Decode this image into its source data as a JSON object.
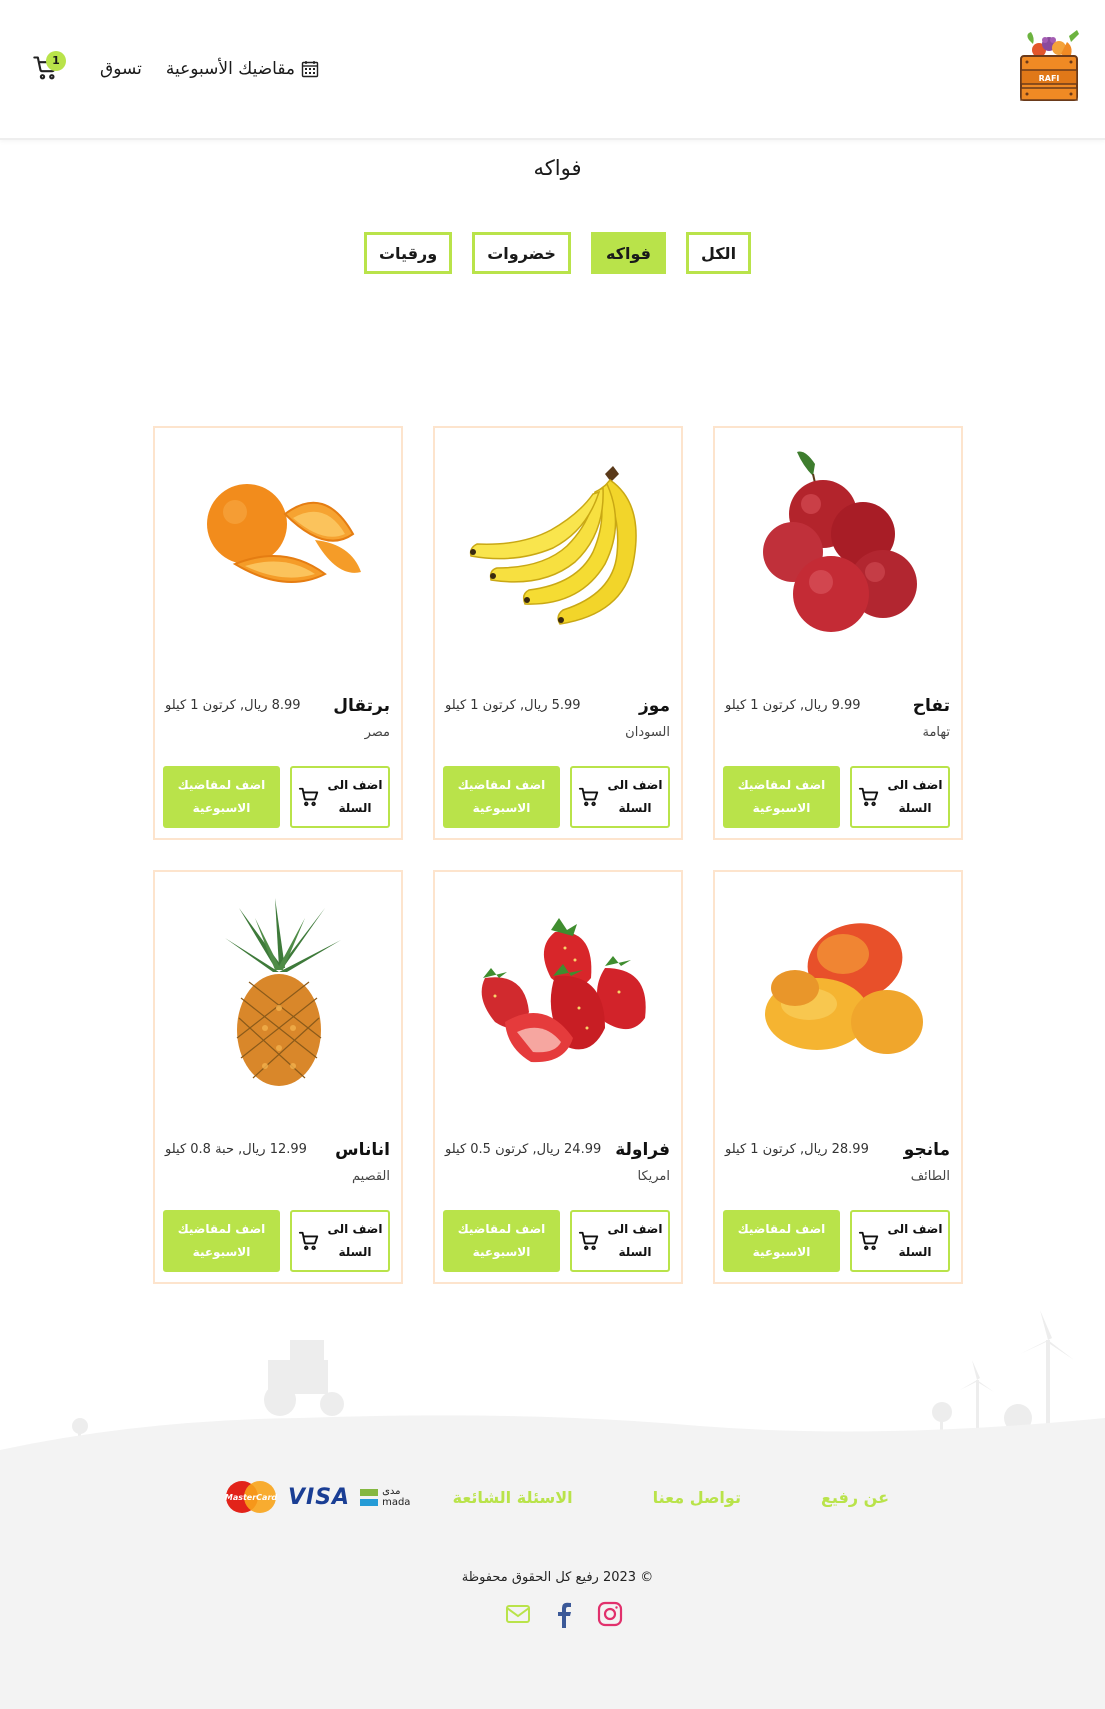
{
  "header": {
    "cart_count": "1",
    "nav_shop": "تسوق",
    "nav_weekly": "مقاضيك الأسبوعية",
    "logo_text": "RAFI"
  },
  "page_title": "فواكه",
  "filters": [
    {
      "label": "الكل",
      "active": false
    },
    {
      "label": "فواكه",
      "active": true
    },
    {
      "label": "خضروات",
      "active": false
    },
    {
      "label": "ورقيات",
      "active": false
    }
  ],
  "buttons": {
    "add_to_cart_line1": "اضف الى",
    "add_to_cart_line2": "السلة",
    "add_weekly_line1": "اضف لمقاضيك",
    "add_weekly_line2": "الاسبوعية"
  },
  "products": [
    {
      "name": "تفاح",
      "price": "9.99 ريال, كرتون 1 كيلو",
      "origin": "تهامة",
      "image": "apple"
    },
    {
      "name": "موز",
      "price": "5.99 ريال, كرتون 1 كيلو",
      "origin": "السودان",
      "image": "banana"
    },
    {
      "name": "برتقال",
      "price": "8.99 ريال, كرتون 1 كيلو",
      "origin": "مصر",
      "image": "orange"
    },
    {
      "name": "مانجو",
      "price": "28.99 ريال, كرتون 1 كيلو",
      "origin": "الطائف",
      "image": "mango"
    },
    {
      "name": "فراولة",
      "price": "24.99 ريال, كرتون 0.5 كيلو",
      "origin": "امريكا",
      "image": "strawberry"
    },
    {
      "name": "اناناس",
      "price": "12.99 ريال, حبة 0.8 كيلو",
      "origin": "القصيم",
      "image": "pineapple"
    }
  ],
  "footer": {
    "links": [
      "عن رفيع",
      "تواصل معنا",
      "الاسئلة الشائعة"
    ],
    "payments": {
      "mada_ar": "مدى",
      "mada_en": "mada",
      "visa": "VISA",
      "mastercard": "MasterCard"
    },
    "copyright": "© 2023 رفيع كل الحقوق محفوظة"
  },
  "colors": {
    "accent": "#b9e34a",
    "card_border": "#fde4cd",
    "footer_bg": "#f3f3f3"
  }
}
